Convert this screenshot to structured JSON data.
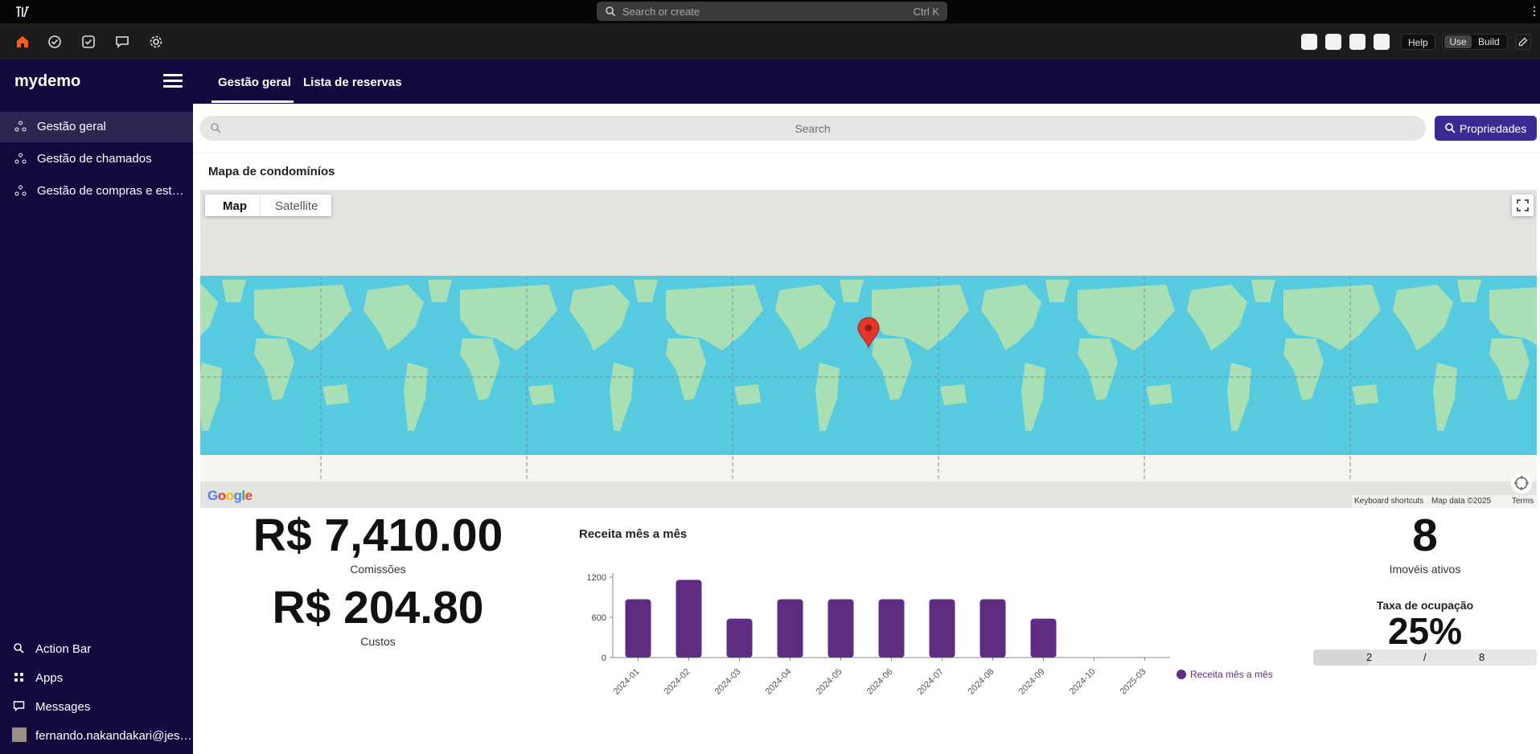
{
  "topbar": {
    "search_placeholder": "Search or create",
    "shortcut": "Ctrl K"
  },
  "toolbar": {
    "help_label": "Help",
    "use_label": "Use",
    "build_label": "Build"
  },
  "sidebar": {
    "app_name": "mydemo",
    "items": [
      {
        "label": "Gestão geral",
        "active": true
      },
      {
        "label": "Gestão de chamados",
        "active": false
      },
      {
        "label": "Gestão de compras e estoque",
        "active": false
      }
    ],
    "bottom": {
      "action_bar": "Action Bar",
      "apps": "Apps",
      "messages": "Messages",
      "user": "fernando.nakandakari@jestor.com"
    }
  },
  "header": {
    "tabs": [
      {
        "label": "Gestão geral",
        "active": true
      },
      {
        "label": "Lista de reservas",
        "active": false
      }
    ]
  },
  "search": {
    "placeholder": "Search",
    "properties_button": "Propriedades"
  },
  "map": {
    "title": "Mapa de condomíníos",
    "type_map": "Map",
    "type_satellite": "Satellite",
    "footer": {
      "shortcuts": "Keyboard shortcuts",
      "data": "Map data ©2025",
      "terms": "Terms"
    },
    "google": "Google"
  },
  "stats": {
    "commissions_value": "R$ 7,410.00",
    "commissions_label": "Comissões",
    "costs_value": "R$ 204.80",
    "costs_label": "Custos",
    "active_value": "8",
    "active_label": "Imovéis ativos",
    "occupancy_title": "Taxa de ocupação",
    "occupancy_value": "25%",
    "occupancy_numerator": "2",
    "occupancy_separator": "/",
    "occupancy_denominator": "8",
    "occupancy_fraction": 0.25
  },
  "colors": {
    "sidebar_bg": "#14093d",
    "accent": "#3a2a93",
    "bar": "#5e2d82",
    "ocean": "#56cbe0",
    "land": "#a8dfb4"
  },
  "chart_data": {
    "type": "bar",
    "title": "Receita mês a mês",
    "categories": [
      "2024-01",
      "2024-02",
      "2024-03",
      "2024-04",
      "2024-05",
      "2024-06",
      "2024-07",
      "2024-08",
      "2024-09",
      "2024-10",
      "2025-03"
    ],
    "series": [
      {
        "name": "Receita mês a mês",
        "values": [
          870,
          1160,
          580,
          870,
          870,
          870,
          870,
          870,
          580,
          0,
          0
        ]
      }
    ],
    "yticks": [
      "0",
      "600",
      "1200"
    ],
    "ylim": [
      0,
      1200
    ],
    "legend": "right"
  }
}
